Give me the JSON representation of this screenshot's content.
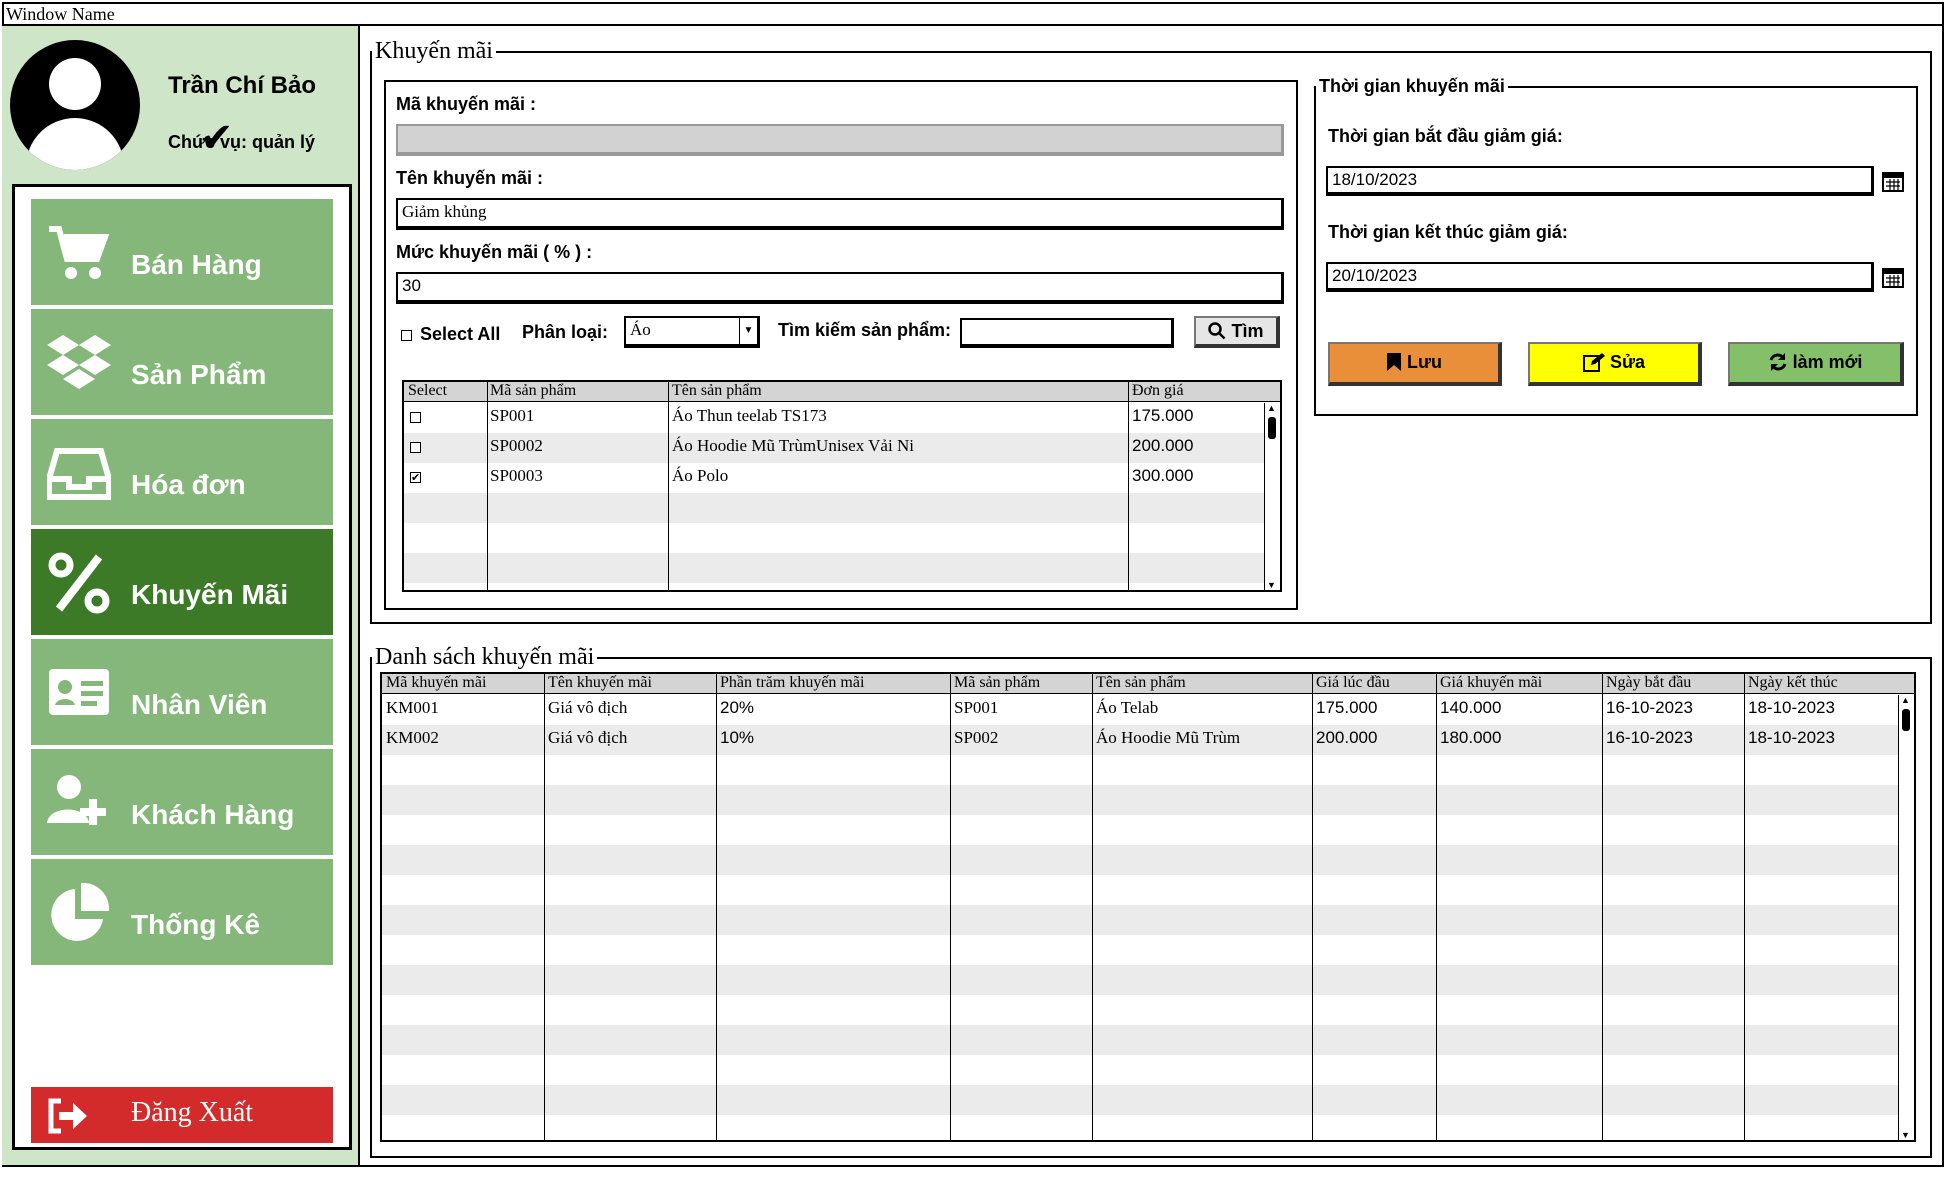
{
  "window": {
    "title": "Window Name"
  },
  "user": {
    "name": "Trần Chí Bảo",
    "role": "Chức vụ: quản lý"
  },
  "menu": {
    "items": [
      {
        "label": "Bán Hàng",
        "icon": "cart-icon"
      },
      {
        "label": "Sản Phẩm",
        "icon": "dropbox-icon"
      },
      {
        "label": "Hóa đơn",
        "icon": "inbox-icon"
      },
      {
        "label": "Khuyến Mãi",
        "icon": "percent-icon"
      },
      {
        "label": "Nhân Viên",
        "icon": "id-card-icon"
      },
      {
        "label": "Khách Hàng",
        "icon": "user-plus-icon"
      },
      {
        "label": "Thống Kê",
        "icon": "pie-chart-icon"
      }
    ],
    "active": "Khuyến Mãi",
    "logout_label": "Đăng Xuất"
  },
  "promo": {
    "legend": "Khuyến mãi",
    "code_label": "Mã khuyến mãi :",
    "code_value": "",
    "name_label": "Tên khuyến mãi :",
    "name_value": "Giảm khủng",
    "rate_label": "Mức khuyến mãi ( % ) :",
    "rate_value": "30",
    "select_all_label": "Select All",
    "category_label": "Phân loại:",
    "category_value": "Áo",
    "search_label": "Tìm kiếm sản phẩm:",
    "search_value": "",
    "search_button": "Tìm",
    "products": {
      "columns": [
        "Select",
        "Mã sản phẩm",
        "Tên sản phẩm",
        "Đơn giá"
      ],
      "rows": [
        {
          "selected": false,
          "code": "SP001",
          "name": "Áo Thun teelab TS173",
          "price": "175.000"
        },
        {
          "selected": false,
          "code": "SP0002",
          "name": "Áo Hoodie Mũ TrùmUnisex Vải Ni",
          "price": "200.000"
        },
        {
          "selected": true,
          "code": "SP0003",
          "name": "Áo Polo",
          "price": "300.000"
        }
      ]
    }
  },
  "period": {
    "legend": "Thời gian khuyến mãi",
    "start_label": "Thời gian bắt đầu giảm giá:",
    "start_value": "18/10/2023",
    "end_label": "Thời gian kết thúc giảm giá:",
    "end_value": "20/10/2023",
    "save_button": "Lưu",
    "edit_button": "Sửa",
    "refresh_button": "làm mới",
    "colors": {
      "save": "#e98f3a",
      "edit": "#ffff00",
      "refresh": "#84c06a"
    }
  },
  "list": {
    "legend": "Danh sách khuyến mãi",
    "columns": [
      "Mã khuyến mãi",
      "Tên khuyến mãi",
      "Phần trăm khuyến mãi",
      "Mã sản phẩm",
      "Tên sản phẩm",
      "Giá lúc đầu",
      "Giá khuyến mãi",
      "Ngày bắt đầu",
      "Ngày kết thúc"
    ],
    "rows": [
      [
        "KM001",
        "Giá vô địch",
        "20%",
        "SP001",
        "Áo Telab",
        "175.000",
        "140.000",
        "16-10-2023",
        "18-10-2023"
      ],
      [
        "KM002",
        "Giá vô địch",
        "10%",
        "SP002",
        "Áo Hoodie Mũ Trùm",
        "200.000",
        "180.000",
        "16-10-2023",
        "18-10-2023"
      ]
    ]
  },
  "colors": {
    "sidebar_bg": "#cfe5c7",
    "menu_item": "#84b779",
    "menu_active": "#3c7a28",
    "logout": "#d32b2b"
  }
}
